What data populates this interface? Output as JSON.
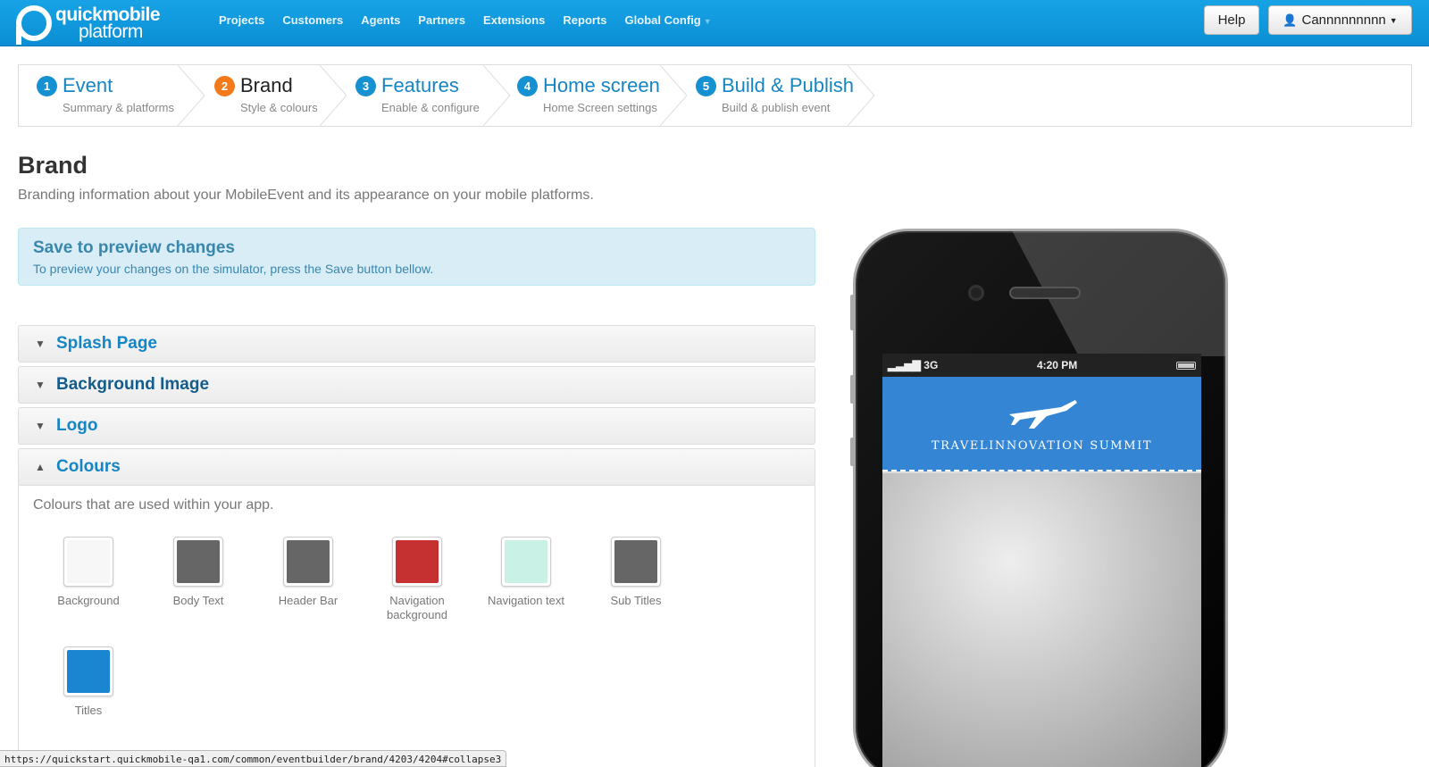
{
  "topbar": {
    "logo_line1": "quickmobile",
    "logo_line2": "platform",
    "nav": [
      "Projects",
      "Customers",
      "Agents",
      "Partners",
      "Extensions",
      "Reports",
      "Global Config"
    ],
    "help_label": "Help",
    "user_label": "Cannnnnnnnn"
  },
  "steps": [
    {
      "num": "1",
      "title": "Event",
      "sub": "Summary & platforms"
    },
    {
      "num": "2",
      "title": "Brand",
      "sub": "Style & colours"
    },
    {
      "num": "3",
      "title": "Features",
      "sub": "Enable & configure"
    },
    {
      "num": "4",
      "title": "Home screen",
      "sub": "Home Screen settings"
    },
    {
      "num": "5",
      "title": "Build & Publish",
      "sub": "Build & publish event"
    }
  ],
  "page": {
    "title": "Brand",
    "lead": "Branding information about your MobileEvent and its appearance on your mobile platforms."
  },
  "alert": {
    "title": "Save to preview changes",
    "body": "To preview your changes on the simulator, press the Save button bellow."
  },
  "accordion": [
    {
      "label": "Splash Page",
      "expanded": false
    },
    {
      "label": "Background Image",
      "expanded": false
    },
    {
      "label": "Logo",
      "expanded": false
    },
    {
      "label": "Colours",
      "expanded": true
    }
  ],
  "colours": {
    "description": "Colours that are used within your app.",
    "swatches": [
      {
        "name": "Background",
        "color": "#f7f7f7"
      },
      {
        "name": "Body Text",
        "color": "#666666"
      },
      {
        "name": "Header Bar",
        "color": "#666666"
      },
      {
        "name": "Navigation background",
        "color": "#c53030"
      },
      {
        "name": "Navigation text",
        "color": "#c9f1e6"
      },
      {
        "name": "Sub Titles",
        "color": "#666666"
      },
      {
        "name": "Titles",
        "color": "#1a86d2"
      }
    ]
  },
  "phone": {
    "carrier": "3G",
    "time": "4:20 PM",
    "app_name": "TRAVELINNOVATION SUMMIT",
    "accent": "#3585d5"
  },
  "status_url": "https://quickstart.quickmobile-qa1.com/common/eventbuilder/brand/4203/4204#collapse3"
}
